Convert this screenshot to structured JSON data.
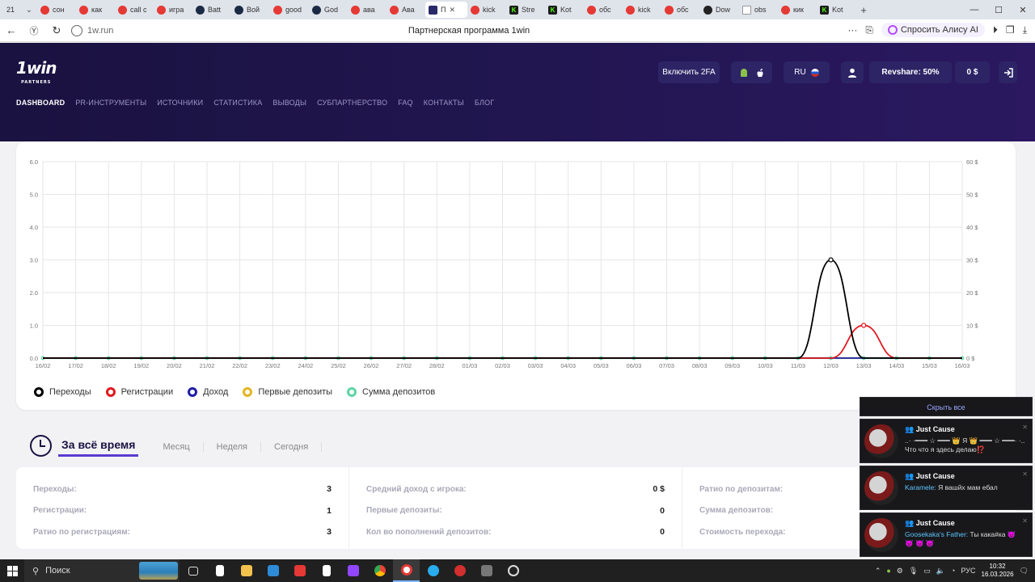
{
  "browser": {
    "tab_count": "21",
    "tabs": [
      {
        "label": "сон",
        "icon": "yandex-icon"
      },
      {
        "label": "как",
        "icon": "yandex-icon"
      },
      {
        "label": "call c",
        "icon": "yandex-icon"
      },
      {
        "label": "игра",
        "icon": "yandex-icon"
      },
      {
        "label": "Batt",
        "icon": "steam-icon"
      },
      {
        "label": "Вой",
        "icon": "steam-icon"
      },
      {
        "label": "good",
        "icon": "yandex-icon"
      },
      {
        "label": "God",
        "icon": "steam-icon"
      },
      {
        "label": "ава",
        "icon": "yandex-icon"
      },
      {
        "label": "Ава",
        "icon": "avito-icon"
      },
      {
        "label": "П",
        "icon": "1win-icon",
        "active": true
      },
      {
        "label": "kick",
        "icon": "yandex-icon"
      },
      {
        "label": "Stre",
        "icon": "kick-icon"
      },
      {
        "label": "Kot",
        "icon": "kick-icon"
      },
      {
        "label": "обс",
        "icon": "yandex-icon"
      },
      {
        "label": "kick",
        "icon": "yandex-icon"
      },
      {
        "label": "обс",
        "icon": "yandex-icon"
      },
      {
        "label": "Dow",
        "icon": "github-icon"
      },
      {
        "label": "obs",
        "icon": "doc-icon"
      },
      {
        "label": "кик",
        "icon": "yandex-icon"
      },
      {
        "label": "Kot",
        "icon": "kick-icon"
      }
    ],
    "url": "1w.run",
    "page_title": "Партнерская программа 1win",
    "alice_label": "Спросить Алису AI"
  },
  "site": {
    "logo_text": "1win",
    "logo_sub": "PARTNERS",
    "nav": [
      "DASHBOARD",
      "PR-ИНСТРУМЕНТЫ",
      "ИСТОЧНИКИ",
      "СТАТИСТИКА",
      "ВЫВОДЫ",
      "СУБПАРТНЕРСТВО",
      "FAQ",
      "КОНТАКТЫ",
      "БЛОГ"
    ],
    "btn_2fa": "Включить 2FA",
    "lang": "RU",
    "revshare": "Revshare: 50%",
    "balance": "0 $"
  },
  "chart_data": {
    "type": "line",
    "x": [
      "16/02",
      "17/02",
      "18/02",
      "19/02",
      "20/02",
      "21/02",
      "22/02",
      "23/02",
      "24/02",
      "25/02",
      "26/02",
      "27/02",
      "28/02",
      "01/03",
      "02/03",
      "03/03",
      "04/03",
      "05/03",
      "06/03",
      "07/03",
      "08/03",
      "09/03",
      "10/03",
      "11/03",
      "12/03",
      "13/03",
      "14/03",
      "15/03",
      "16/03"
    ],
    "y_left_ticks": [
      "0.0",
      "1.0",
      "2.0",
      "3.0",
      "4.0",
      "5.0",
      "6.0"
    ],
    "y_right_ticks": [
      "0 $",
      "10 $",
      "20 $",
      "30 $",
      "40 $",
      "50 $",
      "60 $"
    ],
    "ylim": [
      0,
      6
    ],
    "y2lim": [
      0,
      60
    ],
    "series": [
      {
        "name": "Переходы",
        "color": "#000000",
        "values": [
          0,
          0,
          0,
          0,
          0,
          0,
          0,
          0,
          0,
          0,
          0,
          0,
          0,
          0,
          0,
          0,
          0,
          0,
          0,
          0,
          0,
          0,
          0,
          0,
          3,
          0,
          0,
          0,
          0
        ]
      },
      {
        "name": "Регистрации",
        "color": "#e0191f",
        "values": [
          0,
          0,
          0,
          0,
          0,
          0,
          0,
          0,
          0,
          0,
          0,
          0,
          0,
          0,
          0,
          0,
          0,
          0,
          0,
          0,
          0,
          0,
          0,
          0,
          0,
          1,
          0,
          0,
          0
        ]
      },
      {
        "name": "Доход",
        "color": "#1e1ea8",
        "values": [
          0,
          0,
          0,
          0,
          0,
          0,
          0,
          0,
          0,
          0,
          0,
          0,
          0,
          0,
          0,
          0,
          0,
          0,
          0,
          0,
          0,
          0,
          0,
          0,
          0,
          0,
          0,
          0,
          0
        ]
      },
      {
        "name": "Первые депозиты",
        "color": "#e3b51f",
        "values": [
          0,
          0,
          0,
          0,
          0,
          0,
          0,
          0,
          0,
          0,
          0,
          0,
          0,
          0,
          0,
          0,
          0,
          0,
          0,
          0,
          0,
          0,
          0,
          0,
          0,
          0,
          0,
          0,
          0
        ]
      },
      {
        "name": "Сумма депозитов",
        "color": "#5fd3a6",
        "values": [
          0,
          0,
          0,
          0,
          0,
          0,
          0,
          0,
          0,
          0,
          0,
          0,
          0,
          0,
          0,
          0,
          0,
          0,
          0,
          0,
          0,
          0,
          0,
          0,
          0,
          0,
          0,
          0,
          0
        ]
      }
    ],
    "grid": true,
    "legend": "bottom-left"
  },
  "period": {
    "active": "За всё время",
    "tabs": [
      "Месяц",
      "Неделя",
      "Сегодня"
    ]
  },
  "stats": [
    [
      {
        "label": "Переходы:",
        "value": "3"
      },
      {
        "label": "Регистрации:",
        "value": "1"
      },
      {
        "label": "Ратио по регистрациям:",
        "value": "3"
      }
    ],
    [
      {
        "label": "Средний доход с игрока:",
        "value": "0 $"
      },
      {
        "label": "Первые депозиты:",
        "value": "0"
      },
      {
        "label": "Кол во пополнений депозитов:",
        "value": "0"
      }
    ],
    [
      {
        "label": "Ратио по депозитам:",
        "value": ""
      },
      {
        "label": "Сумма депозитов:",
        "value": ""
      },
      {
        "label": "Стоимость перехода:",
        "value": ""
      }
    ]
  ],
  "notifications": {
    "hide_all": "Скрыть все",
    "items": [
      {
        "title": "Just Cause",
        "user": "",
        "text": "..· ·━━━ ☆ ━━━ 👑 Я 👑 ━━━ ☆ ━━━· ·.. Что что я здесь делаю⁉️"
      },
      {
        "title": "Just Cause",
        "user": "Karamele:",
        "text": "Я вашйх мам ебал"
      },
      {
        "title": "Just Cause",
        "user": "Goosekaka's Father:",
        "text": "Ты кака#ка 😈 😈 😈 😈"
      }
    ]
  },
  "taskbar": {
    "search": "Поиск",
    "lang": "РУС",
    "time": "10:32",
    "date": "16.03.2026"
  }
}
